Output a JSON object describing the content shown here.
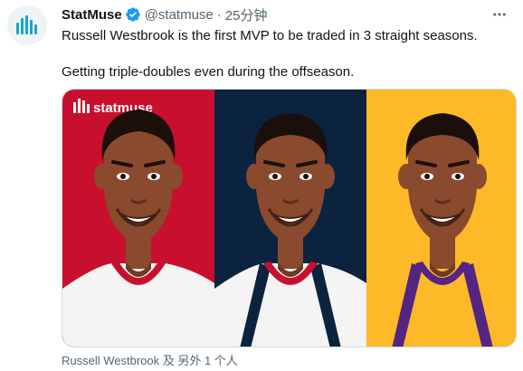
{
  "tweet": {
    "author_name": "StatMuse",
    "handle": "@statmuse",
    "separator": "·",
    "time": "25分钟",
    "text_line1": "Russell Westbrook is the first MVP to be traded in 3 straight seasons.",
    "text_line2": "Getting triple-doubles even during the offseason.",
    "tagged": "Russell Westbrook 及 另外 1 个人"
  },
  "media": {
    "watermark": "statmuse",
    "panels": [
      {
        "team": "rockets",
        "background": "#c8102e",
        "jersey": "#ffffff",
        "trim": "#c8102e"
      },
      {
        "team": "wizards",
        "background": "#0c2340",
        "jersey": "#ffffff",
        "trim": "#c8102e"
      },
      {
        "team": "lakers",
        "background": "#fdb927",
        "jersey": "#fdb927",
        "trim": "#552583"
      }
    ]
  },
  "colors": {
    "accent": "#1d9bf0",
    "text": "#0f1419",
    "muted": "#536471",
    "avatar_icon": "#1aa7c7"
  },
  "icons": {
    "avatar": "statmuse-logo-icon",
    "verified": "verified-badge-icon",
    "more": "more-options-icon"
  }
}
